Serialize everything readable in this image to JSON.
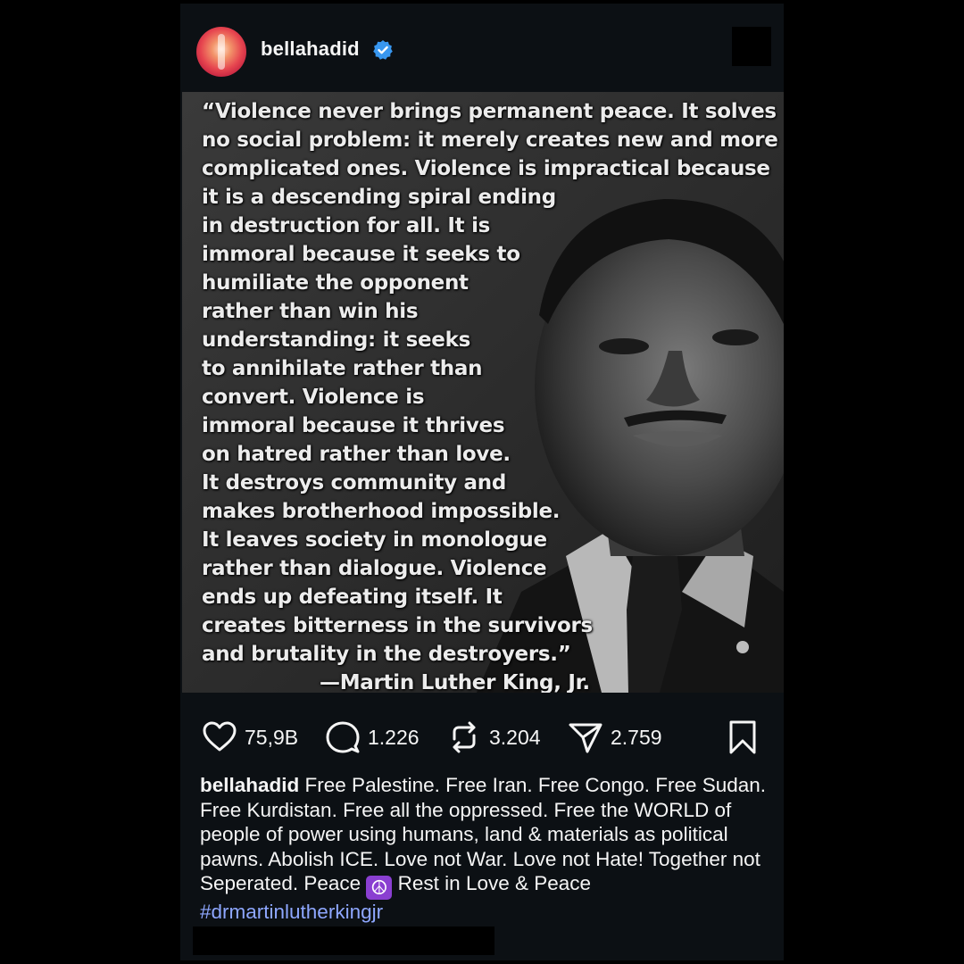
{
  "post": {
    "username": "bellahadid",
    "verified_icon": "verified-badge-icon",
    "accent_color": "#3897f0"
  },
  "image": {
    "quote_lines": [
      "“Violence never brings permanent peace. It solves",
      "no social problem: it merely creates new and more",
      "complicated ones. Violence is impractical because",
      "it is a descending spiral ending",
      "in destruction for all. It is",
      "immoral because it seeks to",
      "humiliate the opponent",
      "rather than win his",
      "understanding: it seeks",
      "to annihilate rather than",
      "convert. Violence is",
      "immoral because it thrives",
      "on hatred rather than love.",
      "It destroys community and",
      "makes brotherhood impossible.",
      "It leaves society in monologue",
      "rather than dialogue. Violence",
      "ends up defeating itself. It",
      "creates bitterness in the survivors",
      "and brutality in the destroyers.”"
    ],
    "attribution": "—Martin Luther King, Jr."
  },
  "actions": {
    "likes": "75,9B",
    "comments": "1.226",
    "reposts": "3.204",
    "shares": "2.759",
    "icons": [
      "heart-icon",
      "comment-icon",
      "repost-icon",
      "share-icon",
      "bookmark-icon"
    ]
  },
  "caption": {
    "username": "bellahadid",
    "text": "Free Palestine. Free Iran. Free Congo. Free Sudan. Free Kurdistan. Free all the oppressed. Free the WORLD of people of power using humans, land & materials as political pawns. Abolish ICE. Love not War. Love not Hate! Together not Seperated. Peace",
    "emoji": "☮",
    "text_after": "Rest in Love & Peace",
    "hashtag": "#drmartinlutherkingjr",
    "hashtag_color": "#8ea7ff"
  }
}
